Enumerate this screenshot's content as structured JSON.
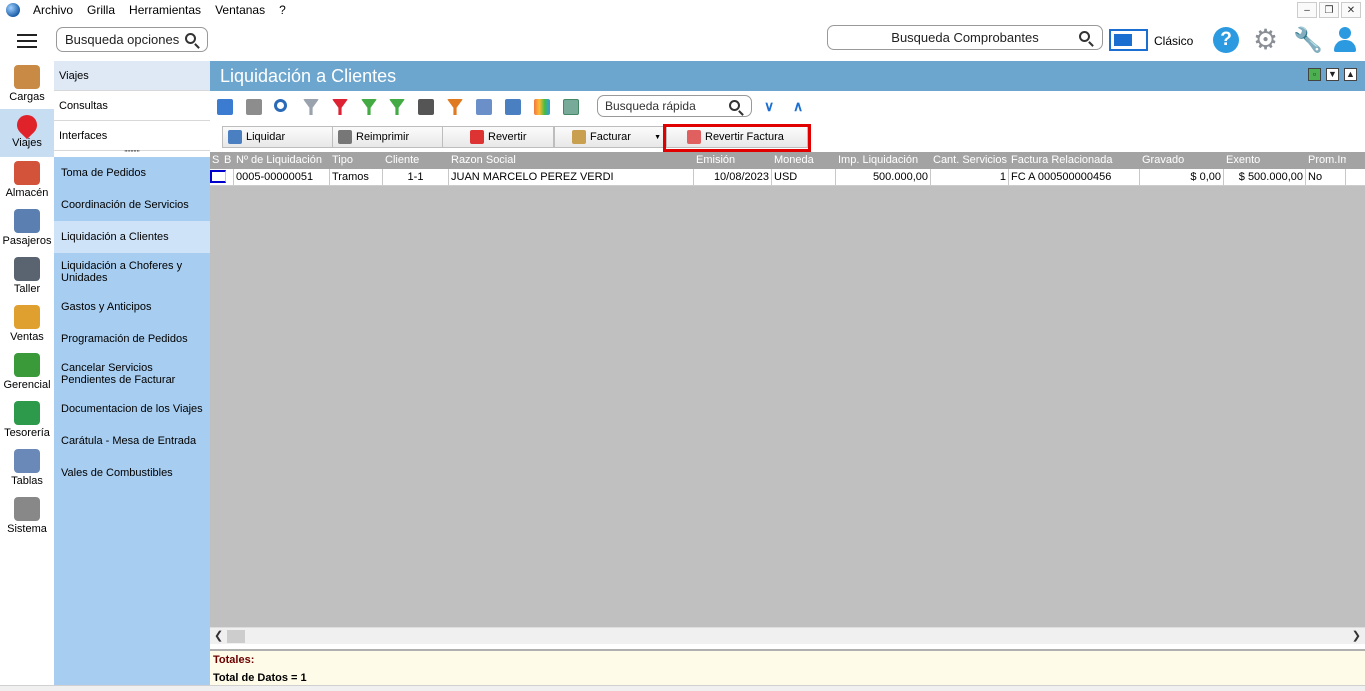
{
  "menu": {
    "items": [
      "Archivo",
      "Grilla",
      "Herramientas",
      "Ventanas",
      "?"
    ]
  },
  "topbar": {
    "search_options": "Busqueda opciones",
    "search_comprobantes": "Busqueda Comprobantes",
    "mode_label": "Clásico"
  },
  "leftnav": {
    "items": [
      {
        "label": "Cargas",
        "icon": "box-icon",
        "color": "#c98a45"
      },
      {
        "label": "Viajes",
        "icon": "map-pin-icon",
        "color": "#e0222a"
      },
      {
        "label": "Almacén",
        "icon": "warehouse-icon",
        "color": "#d2533a"
      },
      {
        "label": "Pasajeros",
        "icon": "passenger-icon",
        "color": "#5a7fb0"
      },
      {
        "label": "Taller",
        "icon": "tools-icon",
        "color": "#5a6470"
      },
      {
        "label": "Ventas",
        "icon": "sales-icon",
        "color": "#e0a030"
      },
      {
        "label": "Gerencial",
        "icon": "bar-chart-icon",
        "color": "#3a9a3a"
      },
      {
        "label": "Tesorería",
        "icon": "money-icon",
        "color": "#2c9a4a"
      },
      {
        "label": "Tablas",
        "icon": "table-icon",
        "color": "#6a88b8"
      },
      {
        "label": "Sistema",
        "icon": "gear-icon",
        "color": "#888888"
      }
    ]
  },
  "submenu": {
    "top": [
      "Viajes",
      "Consultas",
      "Interfaces"
    ],
    "items": [
      "Toma de Pedidos",
      "Coordinación de Servicios",
      "Liquidación a Clientes",
      "Liquidación a Choferes y Unidades",
      "Gastos y Anticipos",
      "Programación de Pedidos",
      "Cancelar Servicios Pendientes de Facturar",
      "Documentacion de los Viajes",
      "Carátula - Mesa de Entrada",
      "Vales de Combustibles"
    ]
  },
  "main": {
    "title": "Liquidación a Clientes",
    "quick_search": "Busqueda rápida"
  },
  "actions": {
    "liquidar": "Liquidar",
    "reimprimir": "Reimprimir",
    "revertir": "Revertir",
    "facturar": "Facturar",
    "revertir_factura": "Revertir Factura"
  },
  "grid": {
    "headers": [
      "S",
      "B",
      "Nº de Liquidación",
      "Tipo",
      "Cliente",
      "Razon Social",
      "Emisión",
      "Moneda",
      "Imp. Liquidación",
      "Cant. Servicios",
      "Factura Relacionada",
      "Gravado",
      "Exento",
      "Prom.Im"
    ],
    "rows": [
      [
        "",
        "",
        "0005-00000051",
        "Tramos",
        "1-1",
        "JUAN MARCELO PEREZ VERDI",
        "10/08/2023",
        "USD",
        "500.000,00",
        "1",
        "FC A 000500000456",
        "$ 0,00",
        "$ 500.000,00",
        "No"
      ]
    ]
  },
  "totals": {
    "label": "Totales:",
    "count": "Total de Datos = 1"
  }
}
